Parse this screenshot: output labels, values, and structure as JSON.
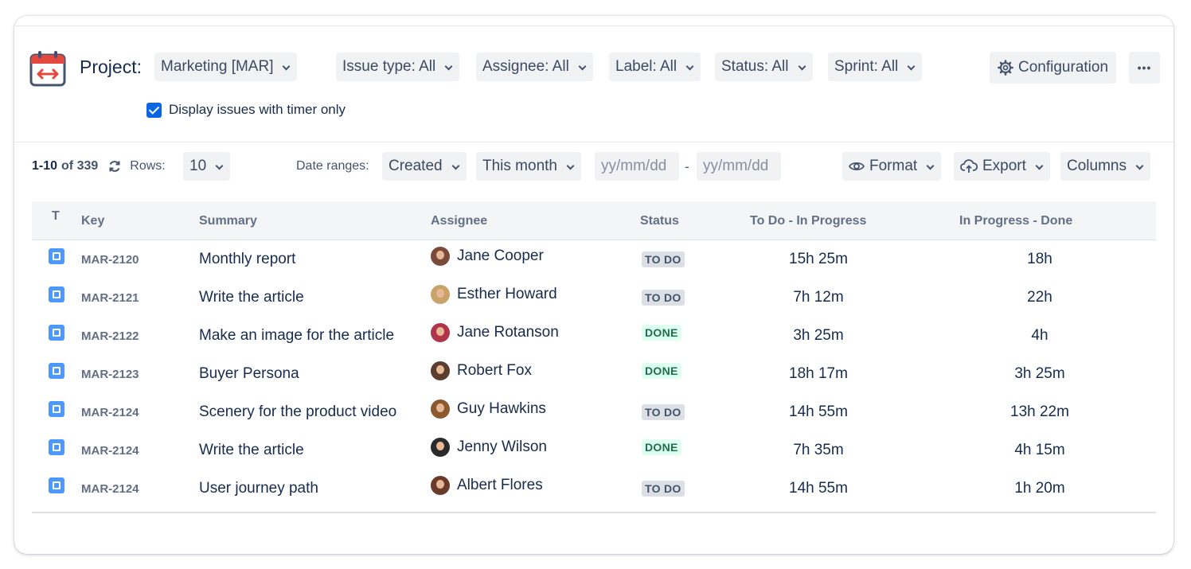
{
  "header": {
    "project_label": "Project:",
    "filters": [
      {
        "label": "Marketing [MAR]"
      },
      {
        "label": "Issue type: All"
      },
      {
        "label": "Assignee: All"
      },
      {
        "label": "Label: All"
      },
      {
        "label": "Status: All"
      },
      {
        "label": "Sprint: All"
      }
    ],
    "configuration_label": "Configuration",
    "more_label": "•••",
    "timer_only_label": "Display issues with timer only",
    "timer_only_checked": true
  },
  "toolbar": {
    "range_text": "1-10",
    "of_text": "of 339",
    "rows_label": "Rows:",
    "rows_value": "10",
    "date_ranges_label": "Date ranges:",
    "date_field": "Created",
    "date_period": "This month",
    "date_from_placeholder": "yy/mm/dd",
    "date_separator": "-",
    "date_to_placeholder": "yy/mm/dd",
    "format_label": "Format",
    "export_label": "Export",
    "columns_label": "Columns"
  },
  "table": {
    "headers": {
      "type": "T",
      "key": "Key",
      "summary": "Summary",
      "assignee": "Assignee",
      "status": "Status",
      "todo_inprogress": "To Do - In Progress",
      "inprogress_done": "In Progress - Done"
    },
    "rows": [
      {
        "key": "MAR-2120",
        "summary": "Monthly report",
        "assignee": "Jane Cooper",
        "status": "TO DO",
        "todo_inprogress": "15h 25m",
        "inprogress_done": "18h"
      },
      {
        "key": "MAR-2121",
        "summary": "Write the article",
        "assignee": "Esther Howard",
        "status": "TO DO",
        "todo_inprogress": "7h 12m",
        "inprogress_done": "22h"
      },
      {
        "key": "MAR-2122",
        "summary": "Make an image for the article",
        "assignee": "Jane Rotanson",
        "status": "DONE",
        "todo_inprogress": "3h 25m",
        "inprogress_done": "4h"
      },
      {
        "key": "MAR-2123",
        "summary": "Buyer Persona",
        "assignee": "Robert Fox",
        "status": "DONE",
        "todo_inprogress": "18h 17m",
        "inprogress_done": "3h 25m"
      },
      {
        "key": "MAR-2124",
        "summary": "Scenery for the product video",
        "assignee": "Guy Hawkins",
        "status": "TO DO",
        "todo_inprogress": "14h 55m",
        "inprogress_done": "13h 22m"
      },
      {
        "key": "MAR-2124",
        "summary": "Write the article",
        "assignee": "Jenny Wilson",
        "status": "DONE",
        "todo_inprogress": "7h 35m",
        "inprogress_done": "4h 15m"
      },
      {
        "key": "MAR-2124",
        "summary": "User journey path",
        "assignee": "Albert Flores",
        "status": "TO DO",
        "todo_inprogress": "14h 55m",
        "inprogress_done": "1h 20m"
      }
    ]
  },
  "colors": {
    "accent": "#0c66e4",
    "todo_bg": "#dcdfe4",
    "todo_text": "#44546f",
    "done_bg": "#dcfff1",
    "done_text": "#216e4e",
    "icon_red": "#e2483d",
    "task_icon": "#4c9aff"
  },
  "icons": {
    "app": "calendar-timer-icon",
    "configuration": "gear-icon",
    "refresh": "refresh-icon",
    "format": "eye-icon",
    "export": "cloud-upload-icon",
    "dropdown": "chevron-down-icon",
    "issue_type": "task-icon"
  }
}
